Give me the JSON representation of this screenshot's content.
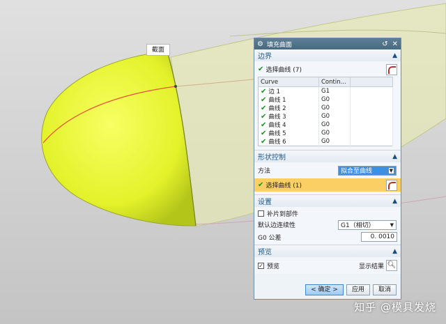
{
  "viewport": {
    "section_label": "截面",
    "watermark": "知乎 @模具发烧"
  },
  "dialog": {
    "title": "填充曲面",
    "boundary": {
      "header": "边界",
      "select_label": "选择曲线 (7)",
      "columns": [
        "Curve",
        "Contin..."
      ],
      "rows": [
        {
          "curve": "边 1",
          "continuity": "G1"
        },
        {
          "curve": "曲线 1",
          "continuity": "G0"
        },
        {
          "curve": "曲线 2",
          "continuity": "G0"
        },
        {
          "curve": "曲线 3",
          "continuity": "G0"
        },
        {
          "curve": "曲线 4",
          "continuity": "G0"
        },
        {
          "curve": "曲线 5",
          "continuity": "G0"
        },
        {
          "curve": "曲线 6",
          "continuity": "G0"
        }
      ]
    },
    "shape": {
      "header": "形状控制",
      "method_label": "方法",
      "method_value": "拟合至曲线",
      "select_label": "选择曲线 (1)"
    },
    "settings": {
      "header": "设置",
      "patch_label": "补片到部件",
      "continuity_label": "默认边连续性",
      "continuity_value": "G1（相切）",
      "tolerance_label": "G0 公差",
      "tolerance_value": "0. 0010"
    },
    "preview": {
      "header": "预览",
      "preview_label": "预览",
      "show_result_label": "显示结果"
    },
    "buttons": {
      "ok": "< 确定 >",
      "apply": "应用",
      "cancel": "取消"
    }
  },
  "colors": {
    "surface_yellow": "#e8f53a",
    "background": "#d2d2d2",
    "header_blue": "#1d5a8e",
    "highlight": "#fbcf64",
    "dropdown_active": "#3f8fe0"
  }
}
